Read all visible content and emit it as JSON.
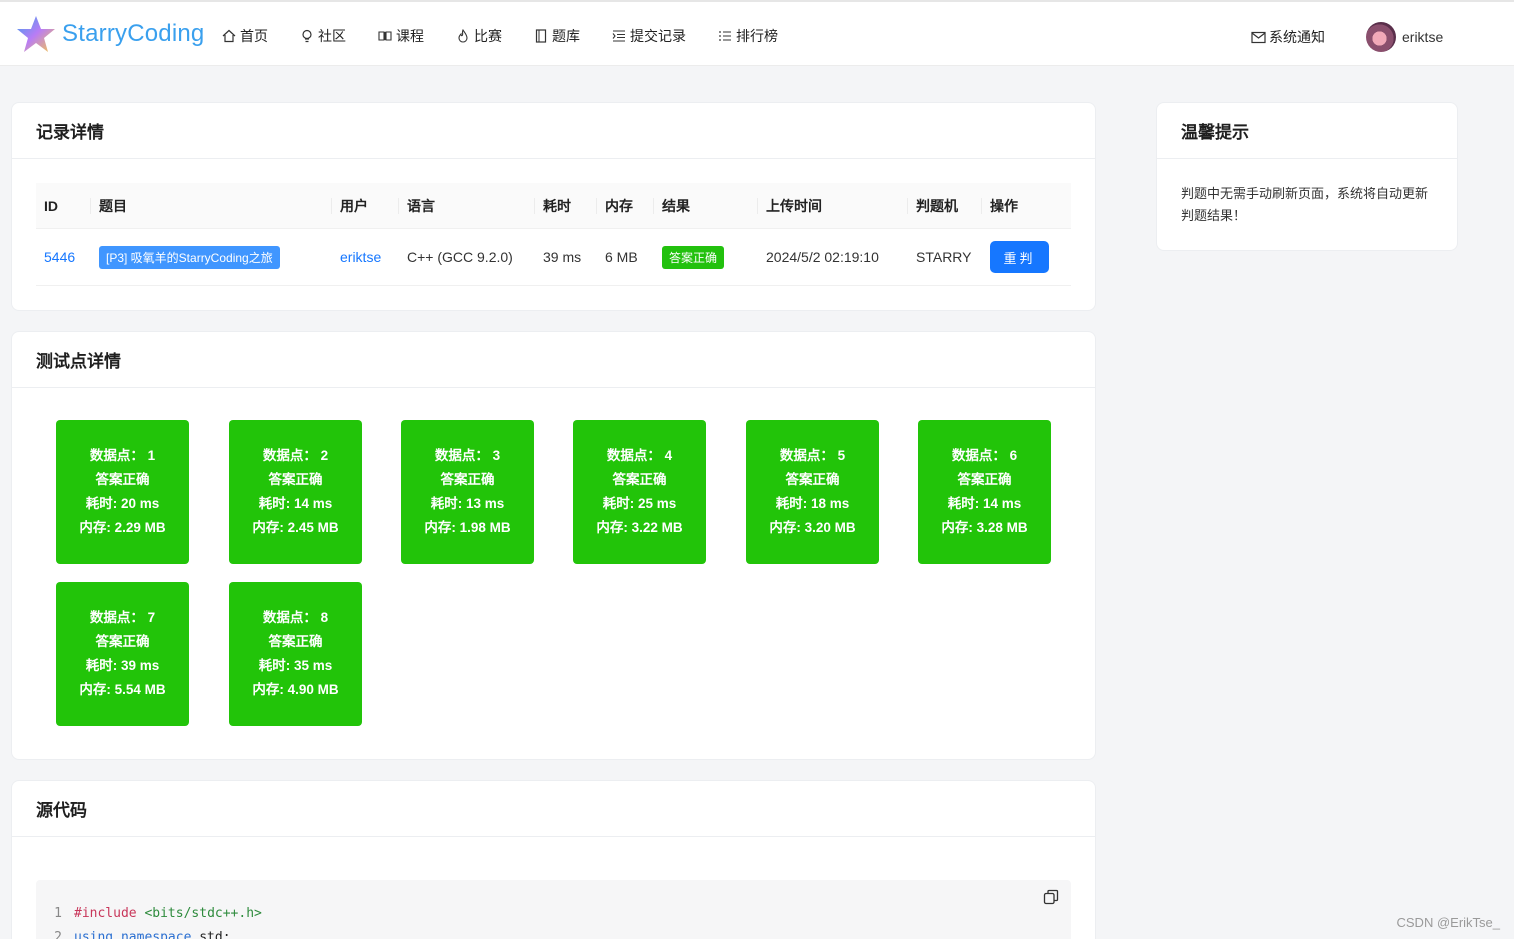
{
  "header": {
    "brand": "StarryCoding",
    "nav": [
      {
        "label": "首页",
        "icon": "home-icon"
      },
      {
        "label": "社区",
        "icon": "bulb-icon"
      },
      {
        "label": "课程",
        "icon": "book-icon"
      },
      {
        "label": "比赛",
        "icon": "fire-icon"
      },
      {
        "label": "题库",
        "icon": "notebook-icon"
      },
      {
        "label": "提交记录",
        "icon": "list-indent-icon"
      },
      {
        "label": "排行榜",
        "icon": "ordered-list-icon"
      }
    ],
    "notify_label": "系统通知",
    "username": "eriktse"
  },
  "record": {
    "title": "记录详情",
    "columns": [
      "ID",
      "题目",
      "用户",
      "语言",
      "耗时",
      "内存",
      "结果",
      "上传时间",
      "判题机",
      "操作"
    ],
    "row": {
      "id": "5446",
      "problem": "[P3] 吸氧羊的StarryCoding之旅",
      "user": "eriktse",
      "language": "C++ (GCC 9.2.0)",
      "time": "39 ms",
      "memory": "6 MB",
      "result": "答案正确",
      "upload_time": "2024/5/2 02:19:10",
      "judger": "STARRY",
      "action": "重判"
    }
  },
  "tips": {
    "title": "温馨提示",
    "text": "判题中无需手动刷新页面，系统将自动更新判题结果！"
  },
  "tests": {
    "title": "测试点详情",
    "items": [
      {
        "label": "数据点： 1",
        "status": "答案正确",
        "time": "耗时: 20 ms",
        "memory": "内存: 2.29 MB"
      },
      {
        "label": "数据点： 2",
        "status": "答案正确",
        "time": "耗时: 14 ms",
        "memory": "内存: 2.45 MB"
      },
      {
        "label": "数据点： 3",
        "status": "答案正确",
        "time": "耗时: 13 ms",
        "memory": "内存: 1.98 MB"
      },
      {
        "label": "数据点： 4",
        "status": "答案正确",
        "time": "耗时: 25 ms",
        "memory": "内存: 3.22 MB"
      },
      {
        "label": "数据点： 5",
        "status": "答案正确",
        "time": "耗时: 18 ms",
        "memory": "内存: 3.20 MB"
      },
      {
        "label": "数据点： 6",
        "status": "答案正确",
        "time": "耗时: 14 ms",
        "memory": "内存: 3.28 MB"
      },
      {
        "label": "数据点： 7",
        "status": "答案正确",
        "time": "耗时: 39 ms",
        "memory": "内存: 5.54 MB"
      },
      {
        "label": "数据点： 8",
        "status": "答案正确",
        "time": "耗时: 35 ms",
        "memory": "内存: 4.90 MB"
      }
    ]
  },
  "source": {
    "title": "源代码",
    "lines": [
      {
        "no": "1",
        "directive": "#include",
        "arg": "<bits/stdc++.h>"
      },
      {
        "no": "2",
        "keyword": "using namespace",
        "rest": "std;"
      }
    ]
  },
  "watermark": "CSDN @ErikTse_",
  "colors": {
    "accent": "#1677ff",
    "success": "#22c409",
    "brand": "#3aa0ee"
  }
}
